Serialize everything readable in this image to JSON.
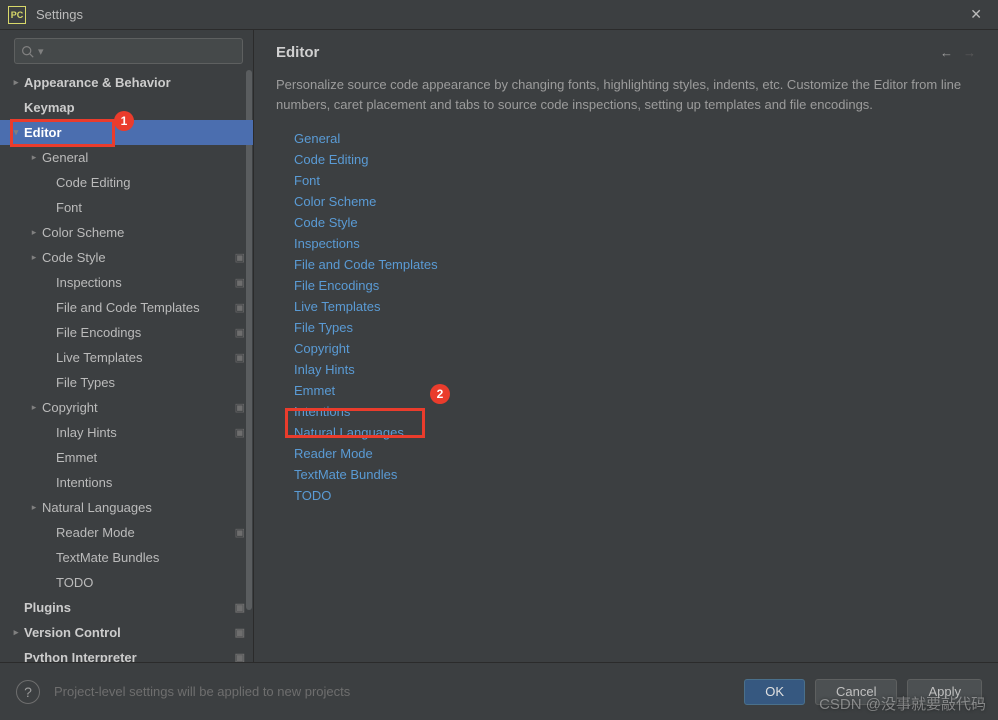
{
  "window": {
    "title": "Settings"
  },
  "search": {
    "placeholder": ""
  },
  "tree": [
    {
      "label": "Appearance & Behavior",
      "indent": 0,
      "arrow": "collapsed",
      "top": true
    },
    {
      "label": "Keymap",
      "indent": 0,
      "arrow": "none",
      "top": true
    },
    {
      "label": "Editor",
      "indent": 0,
      "arrow": "expanded",
      "top": true,
      "selected": true
    },
    {
      "label": "General",
      "indent": 1,
      "arrow": "collapsed"
    },
    {
      "label": "Code Editing",
      "indent": 2,
      "arrow": "none"
    },
    {
      "label": "Font",
      "indent": 2,
      "arrow": "none"
    },
    {
      "label": "Color Scheme",
      "indent": 1,
      "arrow": "collapsed"
    },
    {
      "label": "Code Style",
      "indent": 1,
      "arrow": "collapsed",
      "badge": true
    },
    {
      "label": "Inspections",
      "indent": 2,
      "arrow": "none",
      "badge": true
    },
    {
      "label": "File and Code Templates",
      "indent": 2,
      "arrow": "none",
      "badge": true
    },
    {
      "label": "File Encodings",
      "indent": 2,
      "arrow": "none",
      "badge": true
    },
    {
      "label": "Live Templates",
      "indent": 2,
      "arrow": "none",
      "badge": true
    },
    {
      "label": "File Types",
      "indent": 2,
      "arrow": "none"
    },
    {
      "label": "Copyright",
      "indent": 1,
      "arrow": "collapsed",
      "badge": true
    },
    {
      "label": "Inlay Hints",
      "indent": 2,
      "arrow": "none",
      "badge": true
    },
    {
      "label": "Emmet",
      "indent": 2,
      "arrow": "none"
    },
    {
      "label": "Intentions",
      "indent": 2,
      "arrow": "none"
    },
    {
      "label": "Natural Languages",
      "indent": 1,
      "arrow": "collapsed"
    },
    {
      "label": "Reader Mode",
      "indent": 2,
      "arrow": "none",
      "badge": true
    },
    {
      "label": "TextMate Bundles",
      "indent": 2,
      "arrow": "none"
    },
    {
      "label": "TODO",
      "indent": 2,
      "arrow": "none"
    },
    {
      "label": "Plugins",
      "indent": 0,
      "arrow": "none",
      "top": true,
      "badge": true
    },
    {
      "label": "Version Control",
      "indent": 0,
      "arrow": "collapsed",
      "top": true,
      "badge": true
    },
    {
      "label": "Python Interpreter",
      "indent": 0,
      "arrow": "none",
      "top": true,
      "badge": true
    }
  ],
  "page": {
    "title": "Editor",
    "description": "Personalize source code appearance by changing fonts, highlighting styles, indents, etc. Customize the Editor from line numbers, caret placement and tabs to source code inspections, setting up templates and file encodings.",
    "links": [
      "General",
      "Code Editing",
      "Font",
      "Color Scheme",
      "Code Style",
      "Inspections",
      "File and Code Templates",
      "File Encodings",
      "Live Templates",
      "File Types",
      "Copyright",
      "Inlay Hints",
      "Emmet",
      "Intentions",
      "Natural Languages",
      "Reader Mode",
      "TextMate Bundles",
      "TODO"
    ]
  },
  "footer": {
    "hint": "Project-level settings will be applied to new projects",
    "ok": "OK",
    "cancel": "Cancel",
    "apply": "Apply"
  },
  "annotations": {
    "a1": "1",
    "a2": "2"
  },
  "watermark": "CSDN @没事就要敲代码"
}
